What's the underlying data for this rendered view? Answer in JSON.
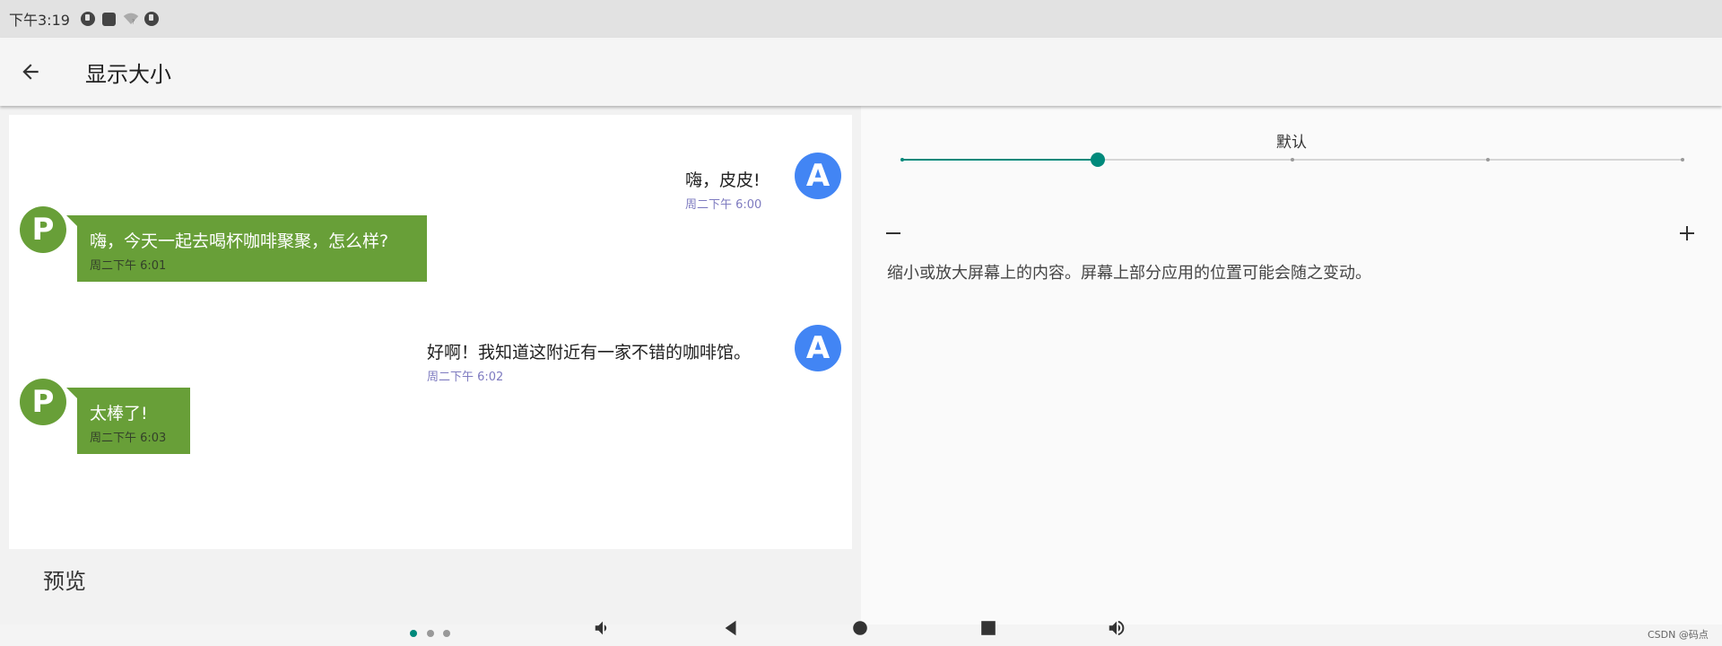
{
  "status_bar": {
    "time": "下午3:19",
    "icons": [
      "notification-app-icon",
      "notification-square-icon",
      "wifi-icon",
      "notification-app-icon"
    ]
  },
  "toolbar": {
    "back_icon": "arrow-left-icon",
    "title": "显示大小"
  },
  "preview": {
    "messages": [
      {
        "sender": "A",
        "side": "right",
        "text": "嗨，皮皮!",
        "time": "周二下午 6:00"
      },
      {
        "sender": "P",
        "side": "left",
        "text": "嗨，今天一起去喝杯咖啡聚聚，怎么样?",
        "time": "周二下午 6:01"
      },
      {
        "sender": "A",
        "side": "right",
        "text": "好啊！我知道这附近有一家不错的咖啡馆。",
        "time": "周二下午 6:02"
      },
      {
        "sender": "P",
        "side": "left",
        "text": "太棒了!",
        "time": "周二下午 6:03"
      }
    ],
    "label": "预览"
  },
  "settings": {
    "value_label": "默认",
    "slider": {
      "steps": 5,
      "selected_index": 1
    },
    "minus_icon": "minus-icon",
    "plus_icon": "plus-icon",
    "description": "缩小或放大屏幕上的内容。屏幕上部分应用的位置可能会随之变动。"
  },
  "pager": {
    "count": 3,
    "active_index": 0
  },
  "nav_bar": {
    "buttons": [
      "volume-down-icon",
      "back-triangle-icon",
      "home-circle-icon",
      "recents-square-icon",
      "volume-up-icon"
    ]
  },
  "watermark": "CSDN @码点",
  "colors": {
    "accent": "#00897b",
    "avatar_a": "#4285f4",
    "avatar_p": "#689f38",
    "timestamp": "#7e7bc0"
  }
}
